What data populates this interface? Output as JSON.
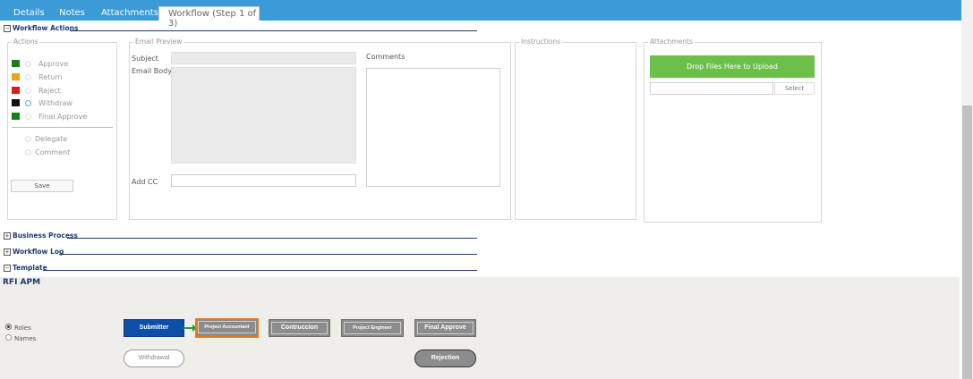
{
  "tabs": [
    {
      "label": "Details"
    },
    {
      "label": "Notes"
    },
    {
      "label": "Attachments"
    },
    {
      "label": "Workflow (Step 1 of 3)",
      "active": true
    }
  ],
  "sections": {
    "workflow_actions": "Workflow Actions",
    "business_process": "Business Process",
    "workflow_log": "Workflow Log",
    "template": "Template"
  },
  "actions": {
    "legend": "Actions",
    "items": [
      {
        "label": "Approve",
        "color": "#1a7f1a"
      },
      {
        "label": "Return",
        "color": "#e8a317"
      },
      {
        "label": "Reject",
        "color": "#e01b1b"
      },
      {
        "label": "Withdraw",
        "color": "#111111"
      },
      {
        "label": "Final Approve",
        "color": "#1a7f1a"
      }
    ],
    "extra": [
      {
        "label": "Delegate"
      },
      {
        "label": "Comment"
      }
    ],
    "save_label": "Save"
  },
  "email": {
    "legend": "Email Preview",
    "subject_label": "Subject",
    "body_label": "Email Body",
    "addcc_label": "Add CC",
    "comments_label": "Comments"
  },
  "instructions": {
    "legend": "Instructions"
  },
  "attachments": {
    "legend": "Attachments",
    "drop_label": "Drop Files Here to Upload",
    "select_label": "Select"
  },
  "template": {
    "title": "RFI APM",
    "view_options": [
      "Roles",
      "Names"
    ],
    "selected_view": "Roles",
    "nodes": [
      "Submitter",
      "Project Accountant",
      "Contruccion",
      "Project Engineer",
      "Final Approve"
    ],
    "selected_node": "Project Accountant",
    "pills": [
      "Withdrawal",
      "Rejection"
    ]
  }
}
